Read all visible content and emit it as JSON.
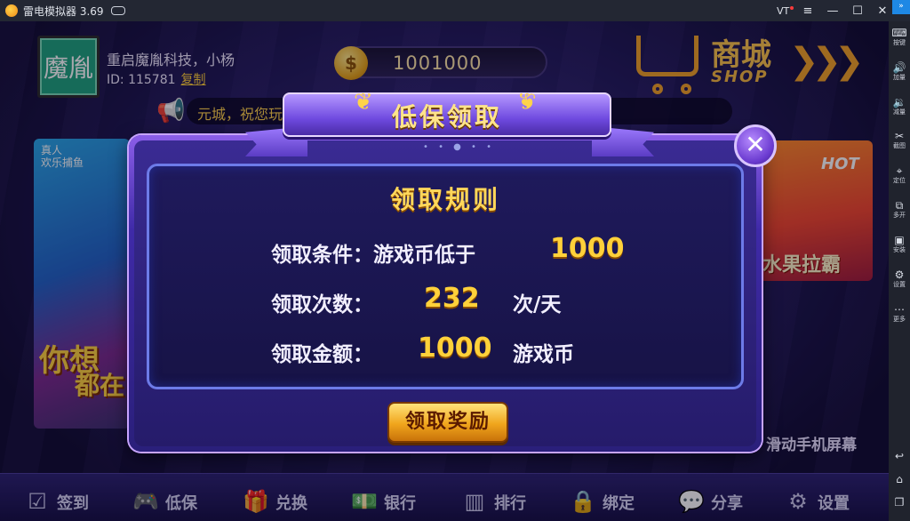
{
  "titlebar": {
    "app_title": "雷电模拟器 3.69",
    "vt_label": "VT",
    "controls": {
      "menu": "≡",
      "minimize": "—",
      "maximize": "☐",
      "close": "✕"
    }
  },
  "sidebar": {
    "items": [
      {
        "icon": "keyboard-icon",
        "glyph": "⌨",
        "label": "按键"
      },
      {
        "icon": "volume-up-icon",
        "glyph": "🔊",
        "label": "加量"
      },
      {
        "icon": "volume-down-icon",
        "glyph": "🔉",
        "label": "减量"
      },
      {
        "icon": "scissors-icon",
        "glyph": "✂",
        "label": "截图"
      },
      {
        "icon": "location-pin-icon",
        "glyph": "⌖",
        "label": "定位"
      },
      {
        "icon": "multi-window-icon",
        "glyph": "⧉",
        "label": "多开"
      },
      {
        "icon": "apk-install-icon",
        "glyph": "▣",
        "label": "安装"
      },
      {
        "icon": "gear-icon",
        "glyph": "⚙",
        "label": "设置"
      },
      {
        "icon": "more-dots-icon",
        "glyph": "⋯",
        "label": "更多"
      }
    ],
    "nav": [
      {
        "icon": "back-icon",
        "glyph": "↩"
      },
      {
        "icon": "home-icon",
        "glyph": "⌂"
      },
      {
        "icon": "recent-apps-icon",
        "glyph": "❐"
      }
    ]
  },
  "user": {
    "avatar_text": "魔胤",
    "name": "重启魔胤科技，小杨",
    "id_label": "ID: 115781",
    "copy_label": "复制"
  },
  "coins": {
    "value": "1001000",
    "icon_glyph": "$"
  },
  "shop": {
    "cn": "商城",
    "en": "SHOP",
    "arrows": "❯❯❯"
  },
  "notice": {
    "text": "元城，祝您玩"
  },
  "cards": {
    "left_title": "真人\n欢乐捕鱼",
    "left_big1": "你想",
    "left_big2": "都在",
    "right_hot": "HOT",
    "right_title": "水果拉霸"
  },
  "swipe_hint": "滑动手机屏幕",
  "bottom_nav": [
    {
      "icon": "checkin-icon",
      "glyph": "☑",
      "label": "签到"
    },
    {
      "icon": "gamepad-icon",
      "glyph": "🎮",
      "label": "低保"
    },
    {
      "icon": "gift-icon",
      "glyph": "🎁",
      "label": "兑换"
    },
    {
      "icon": "bank-icon",
      "glyph": "💵",
      "label": "银行"
    },
    {
      "icon": "ranking-icon",
      "glyph": "▥",
      "label": "排行"
    },
    {
      "icon": "lock-icon",
      "glyph": "🔒",
      "label": "绑定"
    },
    {
      "icon": "chat-share-icon",
      "glyph": "💬",
      "label": "分享"
    },
    {
      "icon": "gear-icon",
      "glyph": "⚙",
      "label": "设置"
    }
  ],
  "dialog": {
    "header": "低保领取",
    "rules_title": "领取规则",
    "condition_label": "领取条件：游戏币低于",
    "condition_value": "1000",
    "times_label": "领取次数：",
    "times_value": "232",
    "times_unit": "次/天",
    "amount_label": "领取金额：",
    "amount_value": "1000",
    "amount_unit": "游戏币",
    "claim_button": "领取奖励",
    "close_glyph": "✕"
  },
  "colors": {
    "accent_gold": "#ffd13a",
    "dialog_purple": "#3a2b93",
    "emulator_bar": "#232733"
  }
}
